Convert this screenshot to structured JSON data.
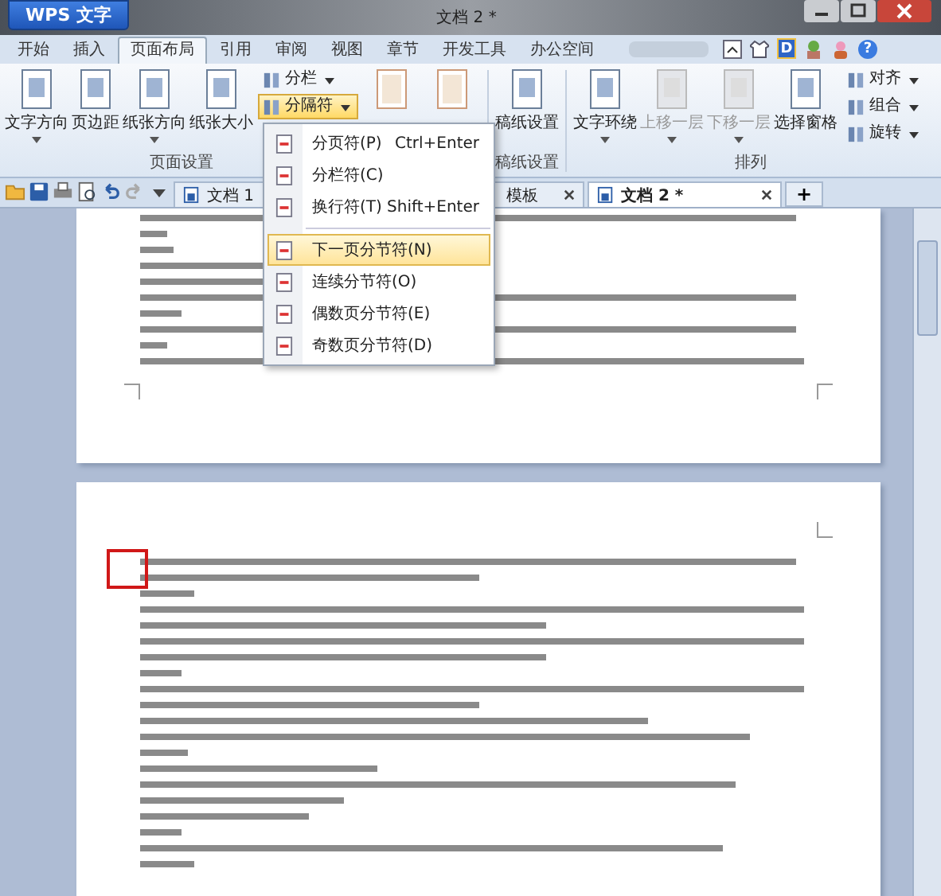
{
  "window": {
    "app_button": "WPS 文字",
    "title": "文档 2 *"
  },
  "ribbon_tabs": [
    {
      "label": "开始",
      "selected": false
    },
    {
      "label": "插入",
      "selected": false
    },
    {
      "label": "页面布局",
      "selected": true
    },
    {
      "label": "引用",
      "selected": false
    },
    {
      "label": "审阅",
      "selected": false
    },
    {
      "label": "视图",
      "selected": false
    },
    {
      "label": "章节",
      "selected": false
    },
    {
      "label": "开发工具",
      "selected": false
    },
    {
      "label": "办公空间",
      "selected": false
    }
  ],
  "top_right": {
    "badge": "D",
    "help": "?"
  },
  "ribbon_groups": [
    {
      "label": "页面设置",
      "buttons": [
        {
          "kind": "large",
          "label": "文字方向",
          "dropdown": true,
          "disabled": false
        },
        {
          "kind": "large",
          "label": "页边距",
          "dropdown": false,
          "disabled": false
        },
        {
          "kind": "large",
          "label": "纸张方向",
          "dropdown": true,
          "disabled": false
        },
        {
          "kind": "large",
          "label": "纸张大小",
          "dropdown": false,
          "disabled": false
        },
        {
          "kind": "stack",
          "items": [
            {
              "label": "分栏",
              "expanded": false
            },
            {
              "label": "分隔符",
              "expanded": true
            }
          ]
        },
        {
          "kind": "icon"
        },
        {
          "kind": "icon"
        }
      ]
    },
    {
      "label": "稿纸设置",
      "buttons": [
        {
          "kind": "large",
          "label": "稿纸设置",
          "dropdown": false,
          "disabled": false
        }
      ]
    },
    {
      "label": "排列",
      "buttons": [
        {
          "kind": "large",
          "label": "文字环绕",
          "dropdown": true,
          "disabled": false
        },
        {
          "kind": "large",
          "label": "上移一层",
          "dropdown": true,
          "disabled": true
        },
        {
          "kind": "large",
          "label": "下移一层",
          "dropdown": true,
          "disabled": true
        },
        {
          "kind": "large",
          "label": "选择窗格",
          "dropdown": false,
          "disabled": false
        },
        {
          "kind": "stack",
          "items": [
            {
              "label": "对齐",
              "expanded": false
            },
            {
              "label": "组合",
              "expanded": false
            },
            {
              "label": "旋转",
              "expanded": false
            }
          ]
        }
      ]
    }
  ],
  "doc_tabs": [
    {
      "label": "文档 1",
      "selected": false
    },
    {
      "label": "模板",
      "selected": false,
      "closable": true
    },
    {
      "label": "文档 2 *",
      "selected": true,
      "closable": true
    }
  ],
  "new_tab": "+",
  "menu": [
    {
      "label": "分页符(P)",
      "shortcut": "Ctrl+Enter",
      "selected": false,
      "separator_before": false
    },
    {
      "label": "分栏符(C)",
      "selected": false,
      "separator_before": false
    },
    {
      "label": "换行符(T)",
      "shortcut": "Shift+Enter",
      "selected": false,
      "separator_before": false
    },
    {
      "label": "下一页分节符(N)",
      "selected": true,
      "separator_before": true
    },
    {
      "label": "连续分节符(O)",
      "selected": false,
      "separator_before": false
    },
    {
      "label": "偶数页分节符(E)",
      "selected": false,
      "separator_before": false
    },
    {
      "label": "奇数页分节符(D)",
      "selected": false,
      "separator_before": false
    }
  ]
}
